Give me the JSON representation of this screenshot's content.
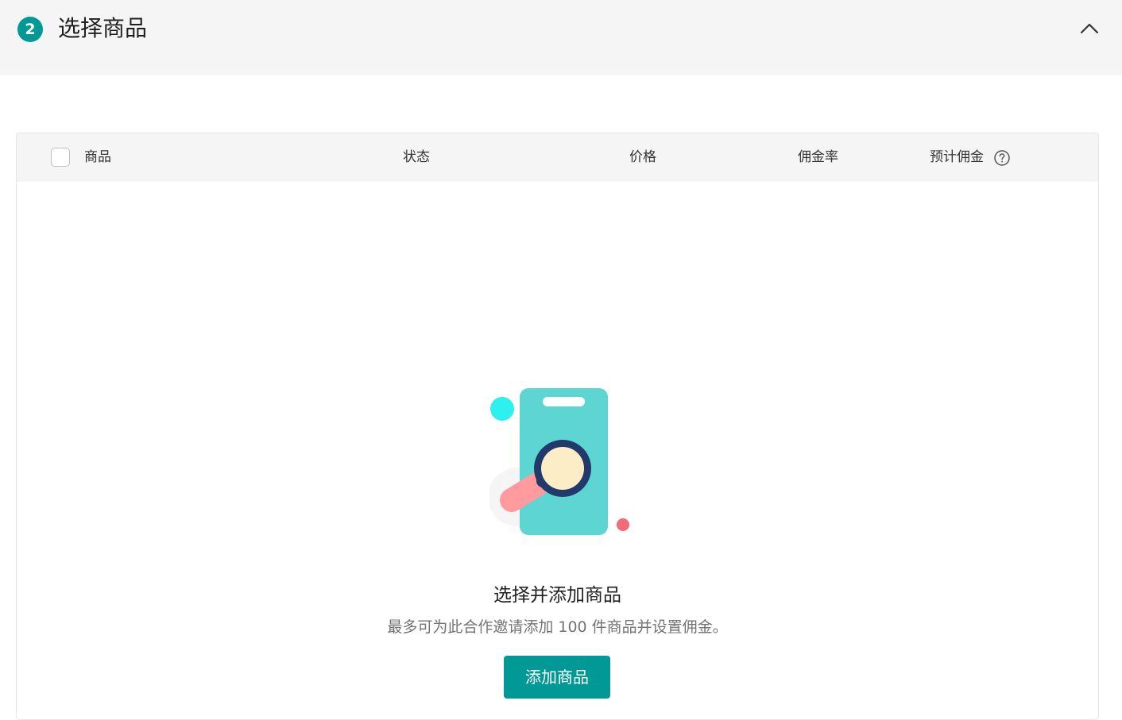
{
  "section": {
    "step_number": "2",
    "title": "选择商品",
    "collapse_icon": "chevron-up-icon"
  },
  "table": {
    "columns": {
      "product": "商品",
      "status": "状态",
      "price": "价格",
      "commission_rate": "佣金率",
      "estimated_commission": "预计佣金"
    },
    "help_icon": "question-circle-icon"
  },
  "empty_state": {
    "illustration": "phone-magnifier-illustration",
    "title": "选择并添加商品",
    "description": "最多可为此合作邀请添加 100 件商品并设置佣金。",
    "button_label": "添加商品"
  },
  "colors": {
    "accent": "#009995",
    "header_bg": "#f5f5f5",
    "phone": "#5dd6d3",
    "lens_ring": "#223a6b",
    "lens_glass": "#fdedc6",
    "dot_cyan": "#2ef0ee",
    "dot_pink": "#f56a78",
    "handle_pink": "#ff9a9e"
  }
}
